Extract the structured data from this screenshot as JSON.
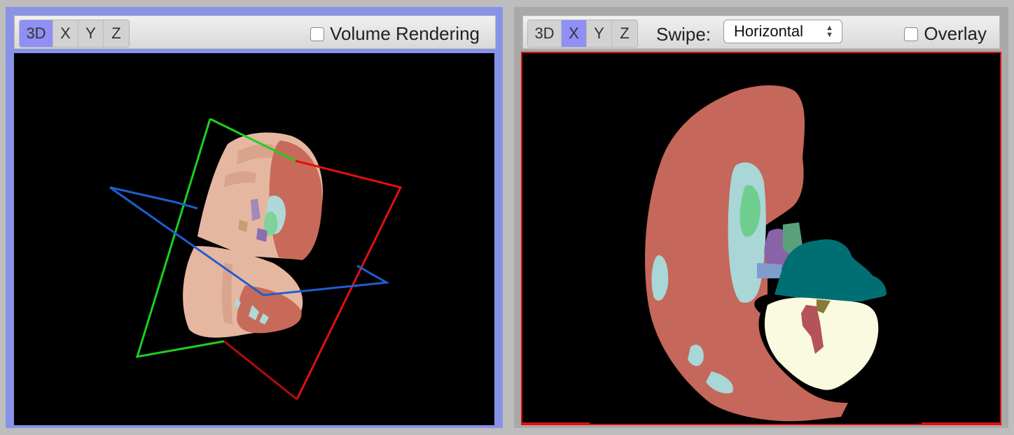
{
  "panels": {
    "left": {
      "view_buttons": [
        "3D",
        "X",
        "Y",
        "Z"
      ],
      "active_view": "3D",
      "checkbox_label": "Volume Rendering",
      "checkbox_checked": false
    },
    "right": {
      "view_buttons": [
        "3D",
        "X",
        "Y",
        "Z"
      ],
      "active_view": "X",
      "swipe_label": "Swipe:",
      "swipe_value": "Horizontal",
      "checkbox_label": "Overlay",
      "checkbox_checked": false
    }
  },
  "colors": {
    "active_panel_border": "#8892e6",
    "inactive_panel_border": "#a9a9a9",
    "active_button": "#8f8ff5",
    "slice_border": "#dd1111",
    "plane_x": "#1ecf1e",
    "plane_y": "#e01010",
    "plane_z": "#1e5fd0"
  }
}
